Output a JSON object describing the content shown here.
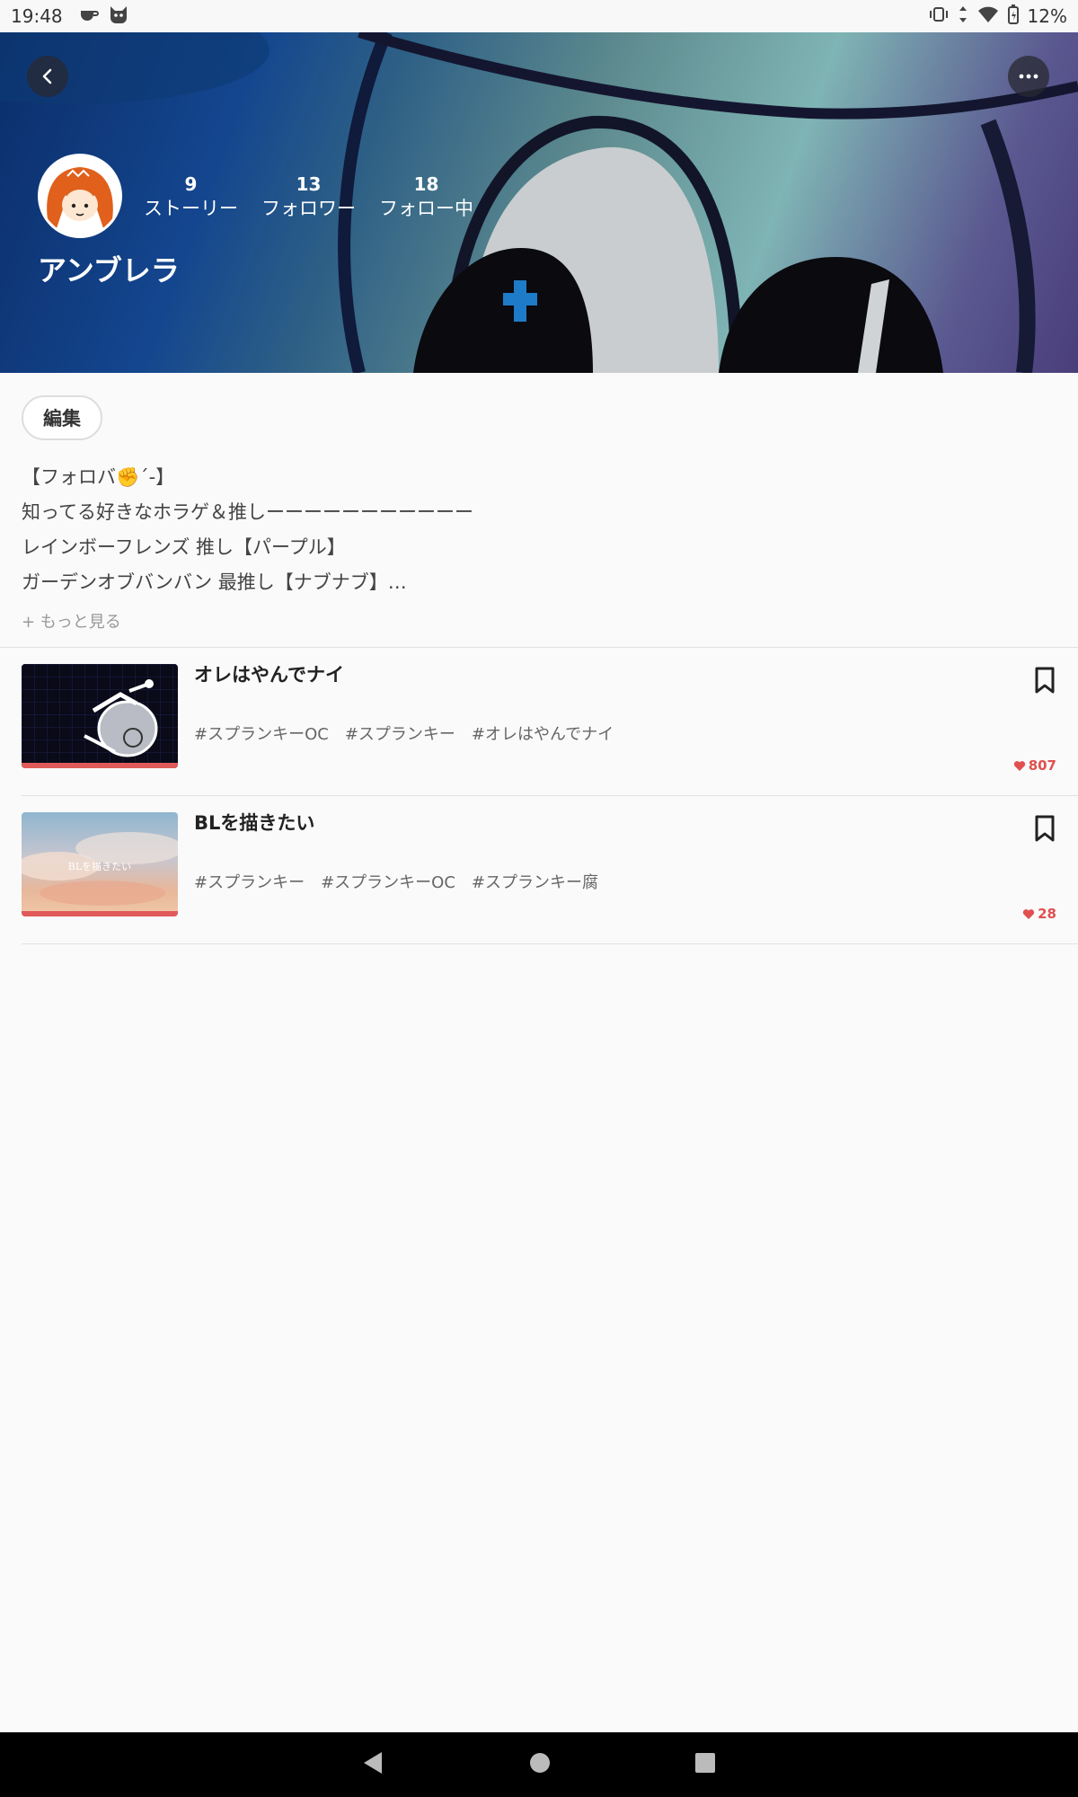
{
  "status_bar": {
    "time": "19:48",
    "battery": "12%"
  },
  "profile": {
    "username": "アンブレラ",
    "stats": [
      {
        "count": "9",
        "label": "ストーリー"
      },
      {
        "count": "13",
        "label": "フォロワー"
      },
      {
        "count": "18",
        "label": "フォロー中"
      }
    ],
    "edit_label": "編集",
    "bio_lines": [
      "【フォロバ✊´-】",
      "知ってる好きなホラゲ＆推しーーーーーーーーーーー",
      "レインボーフレンズ 推し【パープル】",
      "ガーデンオブバンバン 最推し【ナブナブ】…"
    ],
    "more_label": "+ もっと見る"
  },
  "stories": [
    {
      "title": "オレはやんでナイ",
      "tags": [
        "#スプランキーOC",
        "#スプランキー",
        "#オレはやんでナイ"
      ],
      "likes": "807",
      "thumb_text": ""
    },
    {
      "title": "BLを描きたい",
      "tags": [
        "#スプランキー",
        "#スプランキーOC",
        "#スプランキー腐"
      ],
      "likes": "28",
      "thumb_text": "BLを描きたい"
    }
  ],
  "colors": {
    "accent": "#e05050",
    "banner_dark": "#0b2e6a"
  }
}
